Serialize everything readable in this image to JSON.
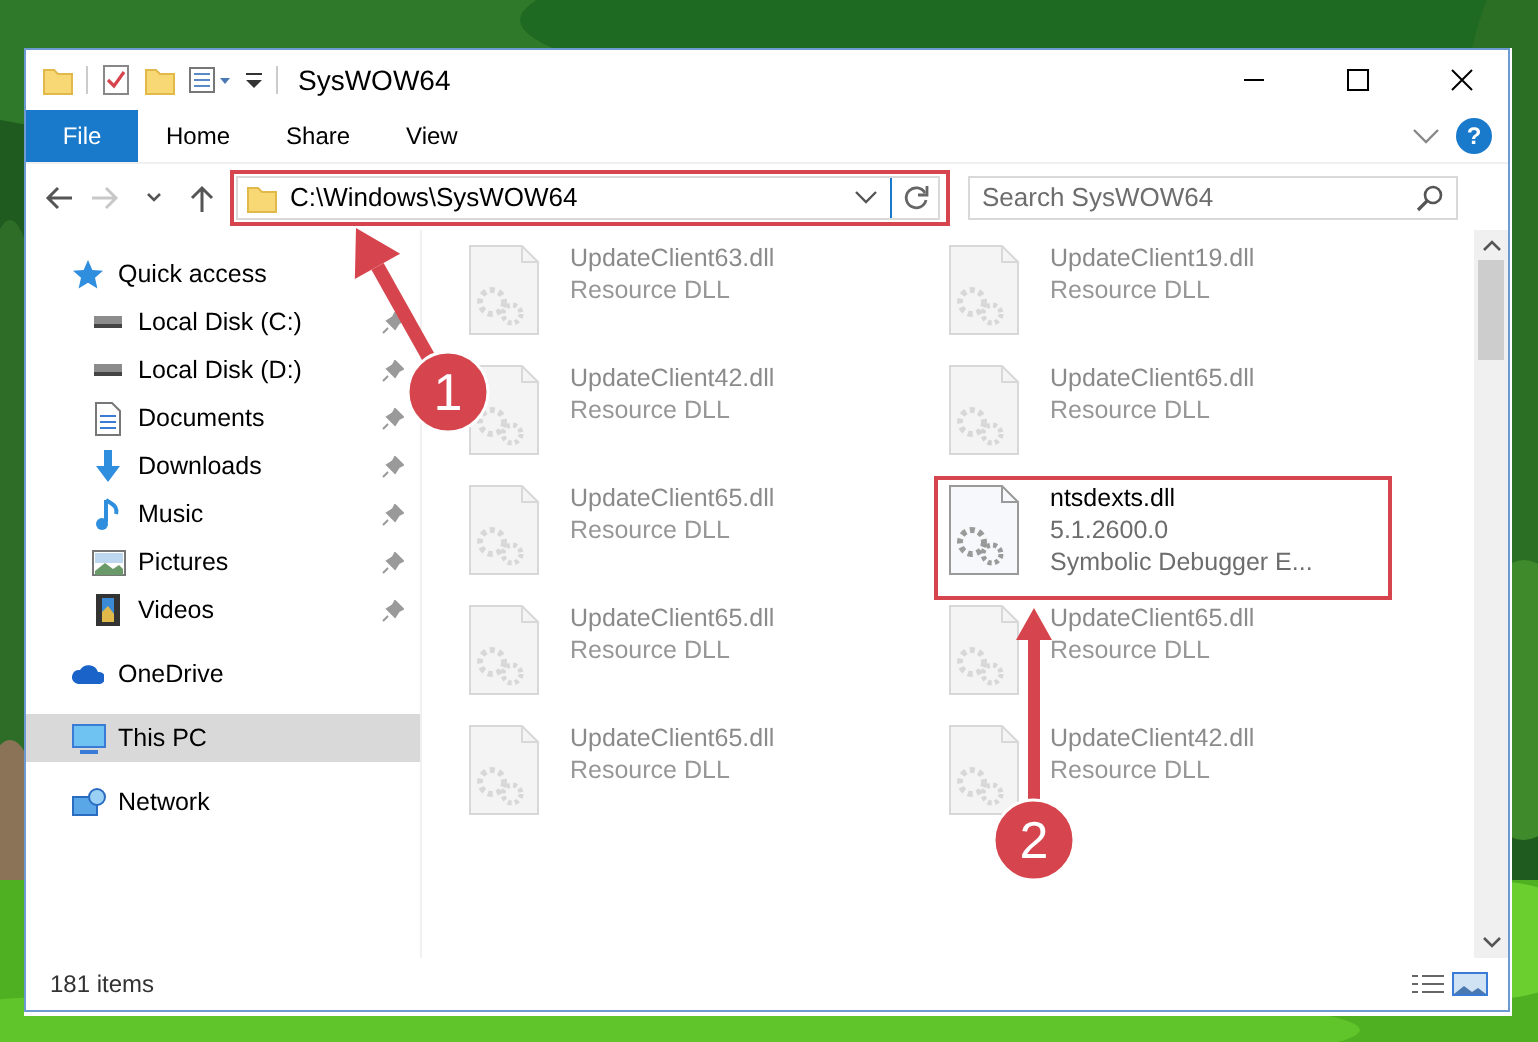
{
  "window": {
    "title": "SysWOW64"
  },
  "ribbon": {
    "tabs": [
      {
        "label": "File",
        "kind": "file",
        "selected": false
      },
      {
        "label": "Home",
        "kind": "tab",
        "selected": false
      },
      {
        "label": "Share",
        "kind": "tab",
        "selected": false
      },
      {
        "label": "View",
        "kind": "tab",
        "selected": false
      }
    ],
    "help": "?"
  },
  "nav_buttons": [
    {
      "kind": "back",
      "disabled": false
    },
    {
      "kind": "forward",
      "disabled": true
    },
    {
      "kind": "recent",
      "disabled": false
    },
    {
      "kind": "up",
      "disabled": false
    }
  ],
  "address": {
    "path": "C:\\Windows\\SysWOW64"
  },
  "search": {
    "placeholder": "Search SysWOW64"
  },
  "sidebar": {
    "items": [
      {
        "label": "Quick access",
        "kind": "star",
        "selected": false,
        "children": [
          {
            "label": "Local Disk (C:)",
            "kind": "disk",
            "pinned": true
          },
          {
            "label": "Local Disk (D:)",
            "kind": "disk",
            "pinned": true
          },
          {
            "label": "Documents",
            "kind": "documents",
            "pinned": true
          },
          {
            "label": "Downloads",
            "kind": "downloads",
            "pinned": true
          },
          {
            "label": "Music",
            "kind": "music",
            "pinned": true
          },
          {
            "label": "Pictures",
            "kind": "pictures",
            "pinned": true
          },
          {
            "label": "Videos",
            "kind": "videos",
            "pinned": true
          }
        ]
      },
      {
        "label": "OneDrive",
        "kind": "cloud",
        "selected": false
      },
      {
        "label": "This PC",
        "kind": "pc",
        "selected": true
      },
      {
        "label": "Network",
        "kind": "network",
        "selected": false
      }
    ]
  },
  "files": [
    {
      "lines": [
        "UpdateClient63.dll",
        "Resource DLL"
      ],
      "blurred": true
    },
    {
      "lines": [
        "UpdateClient19.dll",
        "Resource DLL"
      ],
      "blurred": true
    },
    {
      "lines": [
        "UpdateClient42.dll",
        "Resource DLL"
      ],
      "blurred": true
    },
    {
      "lines": [
        "UpdateClient65.dll",
        "Resource DLL"
      ],
      "blurred": true
    },
    {
      "lines": [
        "UpdateClient65.dll",
        "Resource DLL"
      ],
      "blurred": true
    },
    {
      "lines": [
        "ntsdexts.dll",
        "5.1.2600.0",
        "Symbolic Debugger E..."
      ],
      "blurred": false
    },
    {
      "lines": [
        "UpdateClient65.dll",
        "Resource DLL"
      ],
      "blurred": true
    },
    {
      "lines": [
        "UpdateClient65.dll",
        "Resource DLL"
      ],
      "blurred": true
    },
    {
      "lines": [
        "UpdateClient65.dll",
        "Resource DLL"
      ],
      "blurred": true
    },
    {
      "lines": [
        "UpdateClient42.dll",
        "Resource DLL"
      ],
      "blurred": true
    }
  ],
  "annotations": {
    "badges": [
      "1",
      "2"
    ]
  },
  "status_bar": {
    "text": "181 items"
  }
}
